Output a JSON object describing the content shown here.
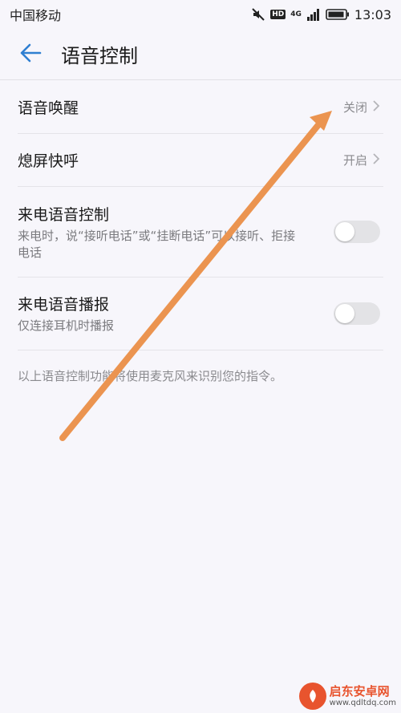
{
  "status_bar": {
    "carrier": "中国移动",
    "hd_badge": "HD",
    "network": "4G",
    "time": "13:03"
  },
  "header": {
    "back_icon": "arrow-left-icon",
    "title": "语音控制"
  },
  "rows": [
    {
      "title": "语音唤醒",
      "value": "关闭"
    },
    {
      "title": "熄屏快呼",
      "value": "开启"
    }
  ],
  "toggle_rows": [
    {
      "title": "来电语音控制",
      "subtitle": "来电时，说“接听电话”或“挂断电话”可以接听、拒接电话",
      "enabled": false
    },
    {
      "title": "来电语音播报",
      "subtitle": "仅连接耳机时播报",
      "enabled": false
    }
  ],
  "footnote": "以上语音控制功能将使用麦克风来识别您的指令。",
  "watermark": {
    "title": "启东安卓网",
    "url": "www.qdltdq.com"
  },
  "colors": {
    "accent": "#2f7fd1",
    "annotation_arrow": "#eb9450",
    "background": "#f7f6fb"
  }
}
